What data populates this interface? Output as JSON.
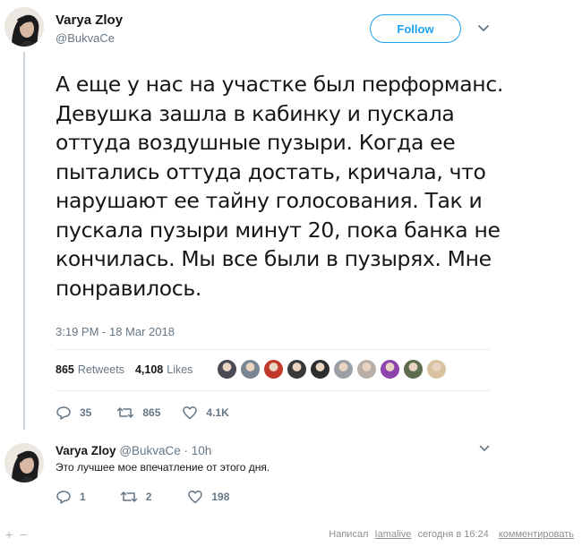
{
  "tweet": {
    "author_name": "Varya Zloy",
    "author_handle": "@BukvaCe",
    "follow_label": "Follow",
    "text": "А еще у нас на участке был перформанс. Девушка зашла в кабинку и пускала оттуда воздушные пузыри. Когда ее пытались оттуда достать, кричала, что нарушают ее тайну голосования. Так и пускала пузыри минут 20, пока банка не кончилась. Мы все были в пузырях. Мне понравилось.",
    "timestamp": "3:19 PM - 18 Mar 2018",
    "retweets_count": "865",
    "retweets_label": "Retweets",
    "likes_count": "4,108",
    "likes_label": "Likes",
    "liker_avatar_colors": [
      "#4a4a55",
      "#7a8594",
      "#c0392b",
      "#3a3a3a",
      "#2d2d2d",
      "#9aa0a6",
      "#b8b0a8",
      "#8e44ad",
      "#5d6d4e",
      "#d9c2a0"
    ],
    "actions": {
      "replies": "35",
      "retweets": "865",
      "likes": "4.1K"
    }
  },
  "reply": {
    "author_name": "Varya Zloy",
    "meta": "@BukvaCe · 10h",
    "text": "Это лучшее мое впечатление от этого дня.",
    "actions": {
      "replies": "1",
      "retweets": "2",
      "likes": "198"
    }
  },
  "footer": {
    "plus": "+",
    "minus": "−",
    "posted_by_label": "Написал",
    "author": "Iamalive",
    "time": "сегодня в 16:24",
    "comment_link": "комментировать"
  },
  "colors": {
    "accent": "#1da1f2",
    "muted": "#657786",
    "text": "#14171a"
  }
}
